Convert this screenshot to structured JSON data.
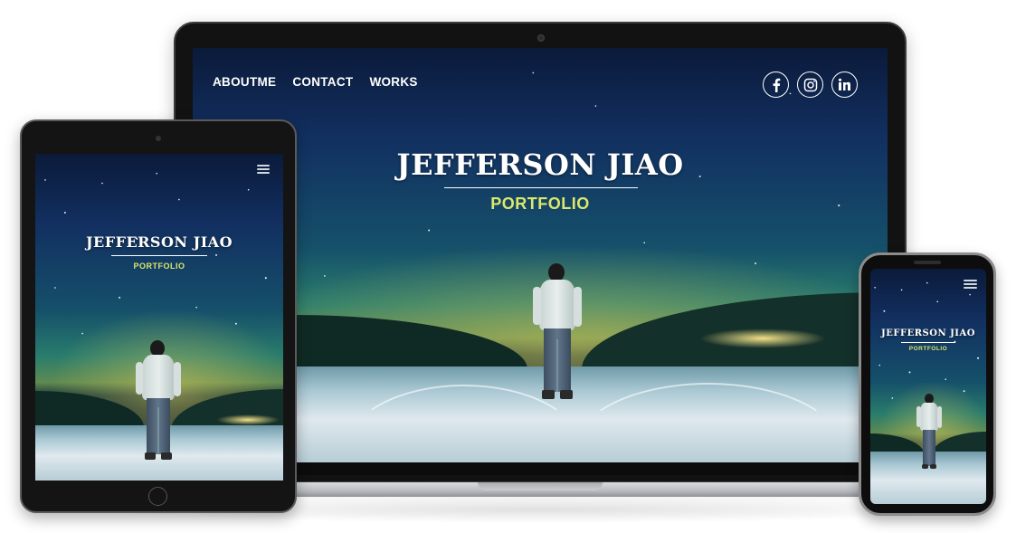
{
  "site": {
    "name": "JEFFERSON JIAO",
    "subtitle": "PORTFOLIO"
  },
  "nav": {
    "items": [
      "ABOUTME",
      "CONTACT",
      "WORKS"
    ]
  },
  "social": {
    "icons": [
      "facebook-icon",
      "instagram-icon",
      "linkedin-icon"
    ]
  },
  "colors": {
    "subtitle": "#dbe86a",
    "nav_text": "#ffffff",
    "device_frame": "#121212"
  }
}
